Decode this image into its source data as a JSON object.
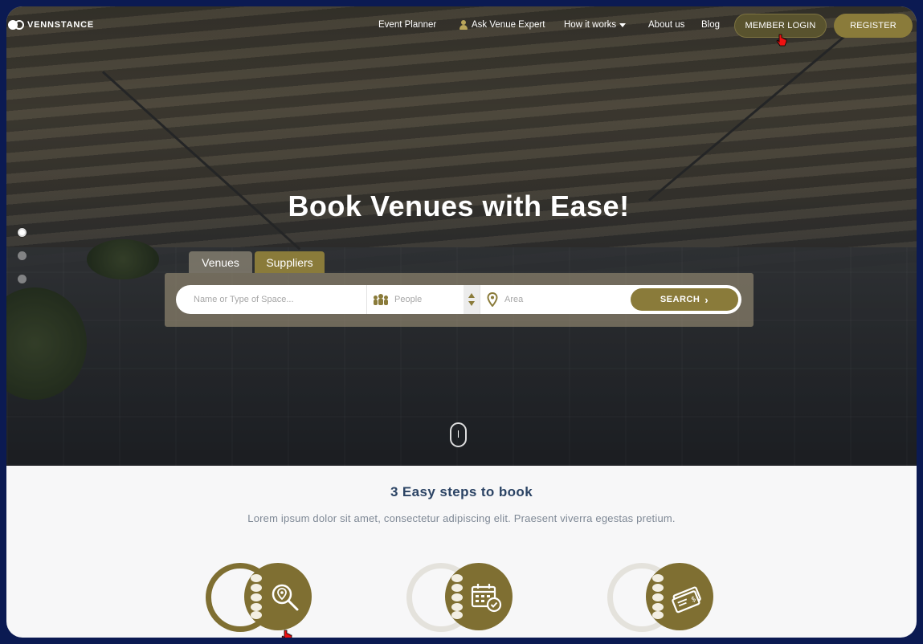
{
  "brand": {
    "name": "VENNSTANCE"
  },
  "nav": {
    "links": [
      "Event Planner",
      "Ask Venue Expert",
      "How it works",
      "About us",
      "Blog"
    ],
    "login_label": "MEMBER LOGIN",
    "register_label": "REGISTER"
  },
  "hero": {
    "title": "Book Venues with Ease!",
    "tabs": [
      "Venues",
      "Suppliers"
    ],
    "search": {
      "name_placeholder": "Name or Type of Space...",
      "people_placeholder": "People",
      "area_placeholder": "Area",
      "button_label": "SEARCH",
      "button_chevron": "›"
    },
    "slider_dots": 3,
    "active_dot": 0
  },
  "steps": {
    "title": "3 Easy steps to book",
    "subtitle": "Lorem ipsum dolor sit amet, consectetur adipiscing elit. Praesent viverra egestas pretium.",
    "items": [
      {
        "icon": "location-search-icon",
        "ring_color": "#7f6f32"
      },
      {
        "icon": "calendar-check-icon",
        "ring_color": "#e4e2dc"
      },
      {
        "icon": "ticket-icon",
        "ring_color": "#e4e2dc"
      }
    ]
  },
  "colors": {
    "accent": "#8a7b3a",
    "accent_dark": "#7f6f32",
    "heading": "#2b4364",
    "frame": "#0b1a52"
  }
}
